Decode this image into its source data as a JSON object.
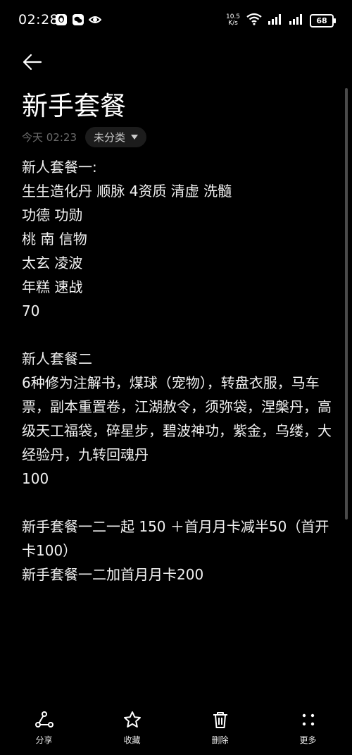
{
  "status": {
    "time": "02:28",
    "net_speed_value": "10.5",
    "net_speed_unit": "K/s",
    "battery": "68"
  },
  "note": {
    "title": "新手套餐",
    "date": "今天 02:23",
    "category": "未分类",
    "lines": [
      "新人套餐一:",
      "生生造化丹 顺脉 4资质 清虚 洗髓",
      "功德 功勋",
      "桃 南 信物",
      "太玄 凌波",
      "年糕 速战",
      "70",
      "",
      "新人套餐二",
      "6种修为注解书，煤球（宠物），转盘衣服，马车票，副本重置卷，江湖赦令，须弥袋，涅槃丹，高级天工福袋，碎星步，碧波神功，紫金，乌缕，大经验丹，九转回魂丹",
      "100",
      "",
      "新手套餐一二一起 150 ＋首月月卡减半50（首开卡100）",
      "新手套餐一二加首月月卡200"
    ]
  },
  "toolbar": {
    "share": "分享",
    "favorite": "收藏",
    "delete": "删除",
    "more": "更多"
  }
}
